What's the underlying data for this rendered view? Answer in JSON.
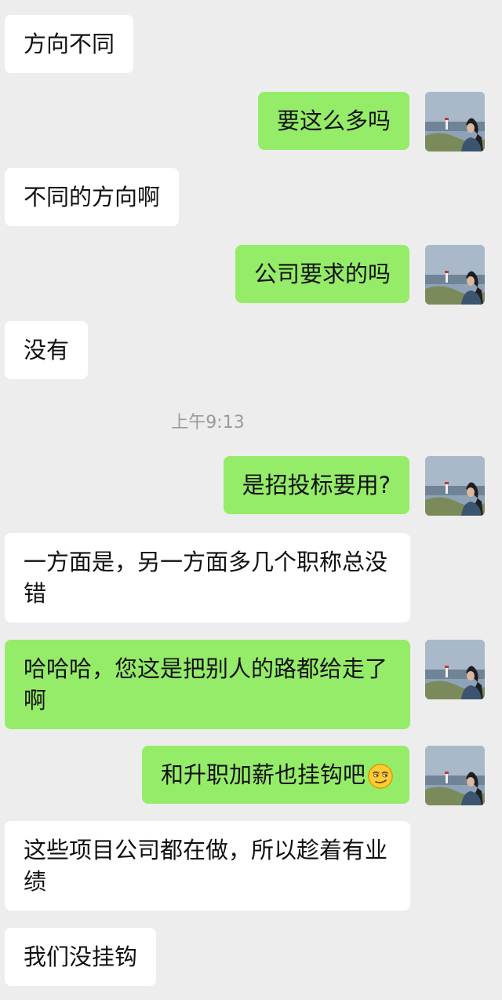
{
  "chat": {
    "timestamp": "上午9:13",
    "messages": [
      {
        "side": "left",
        "text": "方向不同"
      },
      {
        "side": "right",
        "text": "要这么多吗"
      },
      {
        "side": "left",
        "text": "不同的方向啊"
      },
      {
        "side": "right",
        "text": "公司要求的吗"
      },
      {
        "side": "left",
        "text": "没有"
      },
      {
        "side": "right",
        "text": "是招投标要用?"
      },
      {
        "side": "left",
        "text": "一方面是，另一方面多几个职称总没错"
      },
      {
        "side": "right",
        "text": "哈哈哈，您这是把别人的路都给走了啊"
      },
      {
        "side": "right",
        "text": "和升职加薪也挂钩吧",
        "emoji": "smirk-emoji"
      },
      {
        "side": "left",
        "text": "这些项目公司都在做，所以趁着有业绩"
      },
      {
        "side": "left",
        "text": "我们没挂钩"
      }
    ]
  },
  "colors": {
    "background": "#ededed",
    "bubble_left": "#ffffff",
    "bubble_right": "#95ec69",
    "timestamp": "#9a9a9a"
  }
}
